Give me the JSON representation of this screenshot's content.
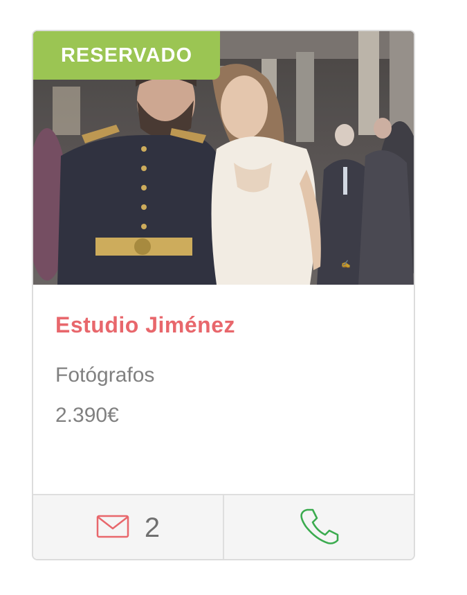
{
  "card": {
    "badge": "RESERVADO",
    "title": "Estudio Jiménez",
    "category": "Fotógrafos",
    "price": "2.390€",
    "messages": {
      "icon": "envelope-icon",
      "count": "2"
    },
    "phone": {
      "icon": "phone-icon"
    },
    "colors": {
      "badge": "#9bc553",
      "title": "#e8676c",
      "envelope": "#e8676c",
      "phone": "#3bab4f",
      "muted_text": "#808080"
    }
  }
}
